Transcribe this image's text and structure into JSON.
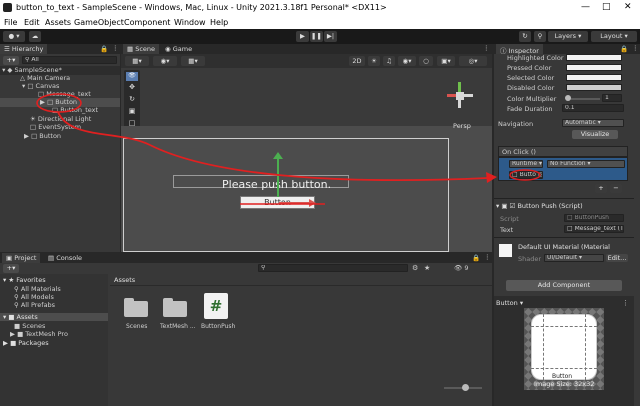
{
  "window": {
    "title": "button_to_text - SampleScene - Windows, Mac, Linux - Unity 2021.3.18f1 Personal* <DX11>"
  },
  "menu": [
    "File",
    "Edit",
    "Assets",
    "GameObject",
    "Component",
    "Window",
    "Help"
  ],
  "toolbar": {
    "layers": "Layers",
    "layout": "Layout"
  },
  "hierarchy": {
    "tab": "Hierarchy",
    "search": "All",
    "items": [
      "SampleScene*",
      "Main Camera",
      "Canvas",
      "Message_text",
      "Button",
      "Button_text",
      "Directional Light",
      "EventSystem",
      "Button"
    ]
  },
  "scene": {
    "tabs": [
      "Scene",
      "Game"
    ],
    "mode_2d": "2D",
    "persp": "Persp",
    "canvas_text": "Please push button.",
    "button_text": "Button"
  },
  "inspector": {
    "tab": "Inspector",
    "colors": [
      "Highlighted Color",
      "Pressed Color",
      "Selected Color",
      "Disabled Color"
    ],
    "color_multiplier_label": "Color Multiplier",
    "color_multiplier_value": "1",
    "fade_label": "Fade Duration",
    "fade_value": "0.1",
    "navigation_label": "Navigation",
    "navigation_value": "Automatic",
    "visualize": "Visualize",
    "onclick": "On Click ()",
    "runtime": "Runtime",
    "no_function": "No Function",
    "obj_field": "Butto",
    "component_title": "Button Push (Script)",
    "script_label": "Script",
    "script_value": "ButtonPush",
    "text_label": "Text",
    "text_value": "Message_text (T",
    "material_title": "Default UI Material (Material",
    "shader_label": "Shader",
    "shader_value": "UI/Default",
    "edit": "Edit...",
    "add_component": "Add Component",
    "preview_title": "Button",
    "preview_caption": "Button",
    "image_size": "Image Size: 32x32"
  },
  "project": {
    "tabs": [
      "Project",
      "Console"
    ],
    "tree": [
      "Favorites",
      "All Materials",
      "All Models",
      "All Prefabs",
      "Assets",
      "Scenes",
      "TextMesh Pro",
      "Packages"
    ],
    "breadcrumb": "Assets",
    "assets": [
      "Scenes",
      "TextMesh ...",
      "ButtonPush"
    ],
    "count": "9"
  }
}
